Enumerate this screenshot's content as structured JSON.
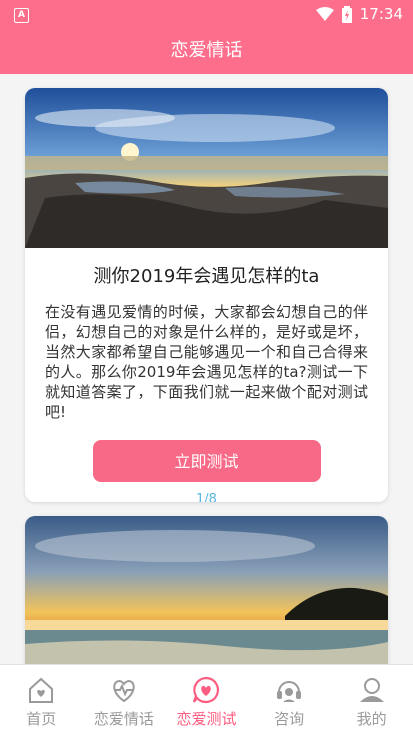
{
  "status_bar": {
    "time": "17:34",
    "icons": [
      "app-notification-icon",
      "wifi-icon",
      "battery-icon"
    ]
  },
  "app_bar": {
    "title": "恋爱情话"
  },
  "quiz_card": {
    "title": "测你2019年会遇见怎样的ta",
    "description": "在没有遇见爱情的时候，大家都会幻想自己的伴侣，幻想自己的对象是什么样的，是好或是坏，当然大家都希望自己能够遇见一个和自己合得来的人。那么你2019年会遇见怎样的ta?测试一下就知道答案了，下面我们就一起来做个配对测试吧!",
    "button_label": "立即测试",
    "pager": "1/8",
    "image": "coastal-sunset-photo"
  },
  "next_card": {
    "image": "ocean-sunset-photo"
  },
  "tab_bar": {
    "tabs": [
      {
        "label": "首页",
        "icon": "home-icon",
        "active": false
      },
      {
        "label": "恋爱情话",
        "icon": "heartbeat-icon",
        "active": false
      },
      {
        "label": "恋爱测试",
        "icon": "heart-chat-icon",
        "active": true
      },
      {
        "label": "咨询",
        "icon": "headset-icon",
        "active": false
      },
      {
        "label": "我的",
        "icon": "person-icon",
        "active": false
      }
    ]
  },
  "colors": {
    "primary": "#fd6e8c",
    "button": "#f86987",
    "pager": "#5ab6e0",
    "tab_inactive": "#9a9a9a",
    "tab_active": "#fd5d80"
  }
}
